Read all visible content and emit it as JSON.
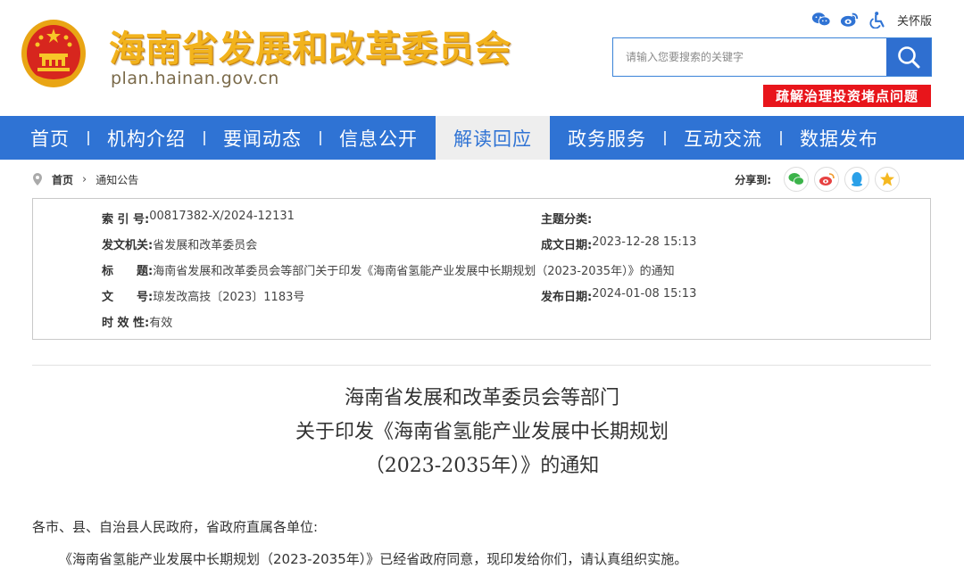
{
  "header": {
    "site_title": "海南省发展和改革委员会",
    "site_url": "plan.hainan.gov.cn",
    "care_mode": "关怀版",
    "search_placeholder": "请输入您要搜索的关键字",
    "banner_link": "疏解治理投资堵点问题"
  },
  "nav": {
    "items": [
      {
        "label": "首页"
      },
      {
        "label": "机构介绍"
      },
      {
        "label": "要闻动态"
      },
      {
        "label": "信息公开"
      },
      {
        "label": "解读回应"
      },
      {
        "label": "政务服务"
      },
      {
        "label": "互动交流"
      },
      {
        "label": "数据发布"
      }
    ],
    "active": "解读回应"
  },
  "breadcrumb": {
    "home": "首页",
    "current": "通知公告"
  },
  "share": {
    "label": "分享到:"
  },
  "meta": {
    "index_label": "索 引 号:",
    "index_value": "00817382-X/2024-12131",
    "topic_label": "主题分类:",
    "topic_value": "",
    "issuer_label": "发文机关:",
    "issuer_value": "省发展和改革委员会",
    "created_label": "成文日期:",
    "created_value": "2023-12-28 15:13",
    "title_label": "标　　题:",
    "title_value": "海南省发展和改革委员会等部门关于印发《海南省氢能产业发展中长期规划（2023-2035年）》的通知",
    "docno_label": "文　　号:",
    "docno_value": "琼发改高技〔2023〕1183号",
    "published_label": "发布日期:",
    "published_value": "2024-01-08 15:13",
    "validity_label": "时 效 性:",
    "validity_value": "有效"
  },
  "doc": {
    "title_line1": "海南省发展和改革委员会等部门",
    "title_line2": "关于印发《海南省氢能产业发展中长期规划",
    "title_line3": "（2023-2035年）》的通知",
    "salutation": "各市、县、自治县人民政府，省政府直属各单位:",
    "paragraph1": "《海南省氢能产业发展中长期规划（2023-2035年）》已经省政府同意，现印发给你们，请认真组织实施。"
  }
}
